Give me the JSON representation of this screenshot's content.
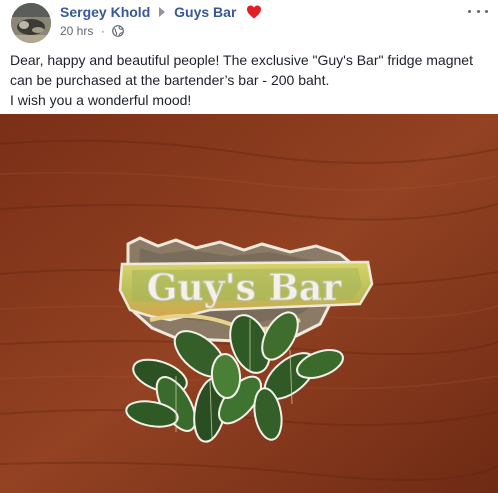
{
  "post": {
    "author": "Sergey Khold",
    "group": "Guys Bar",
    "timestamp": "20 hrs",
    "separator": "·",
    "privacy_icon": "globe-icon",
    "heart_icon": "heart-icon",
    "text_lines": [
      "Dear, happy and beautiful people! The exclusive \"Guy's Bar\" fridge magnet",
      "can be purchased at the bartender’s bar - 200 baht.",
      "I wish you a wonderful mood!"
    ]
  },
  "photo": {
    "magnet_text": "Guy's Bar"
  },
  "colors": {
    "link": "#385898",
    "heart": "#e41e25",
    "wood": "#8a3a1e"
  }
}
